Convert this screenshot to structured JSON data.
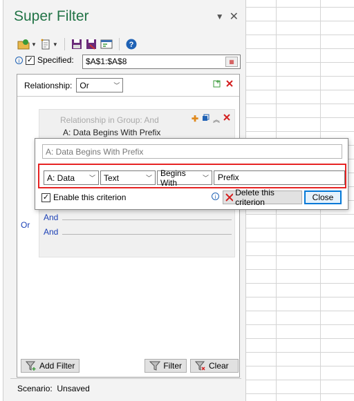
{
  "pane": {
    "title": "Super Filter",
    "pin_icon": "dropdown-caret",
    "close_icon": "close-x"
  },
  "toolbar": {
    "items": [
      "open-folder-icon",
      "new-scenario-icon",
      "save-icon",
      "save-as-icon",
      "manage-icon",
      "help-icon"
    ]
  },
  "specified": {
    "label": "Specified:",
    "checked": true,
    "range": "$A$1:$A$8"
  },
  "relationship": {
    "label": "Relationship:",
    "value": "Or"
  },
  "group": {
    "header": "Relationship in Group:   And",
    "summary": "A: Data  Begins With  Prefix",
    "or_label": "Or",
    "and_rows": [
      "And",
      "And"
    ]
  },
  "editor": {
    "preview": "A: Data  Begins With  Prefix",
    "column": "A: Data",
    "type": "Text",
    "operator": "Begins With",
    "value": "Prefix",
    "enable_label": "Enable this criterion",
    "enable_checked": true,
    "delete_label": "Delete this criterion",
    "close_label": "Close"
  },
  "bottom": {
    "add_filter": "Add Filter",
    "filter": "Filter",
    "clear": "Clear"
  },
  "scenario": {
    "label": "Scenario:",
    "value": "Unsaved"
  },
  "colors": {
    "title_green": "#217346",
    "link_blue": "#1a3fb5",
    "highlight_red": "#e62222",
    "close_border": "#0078d7"
  }
}
